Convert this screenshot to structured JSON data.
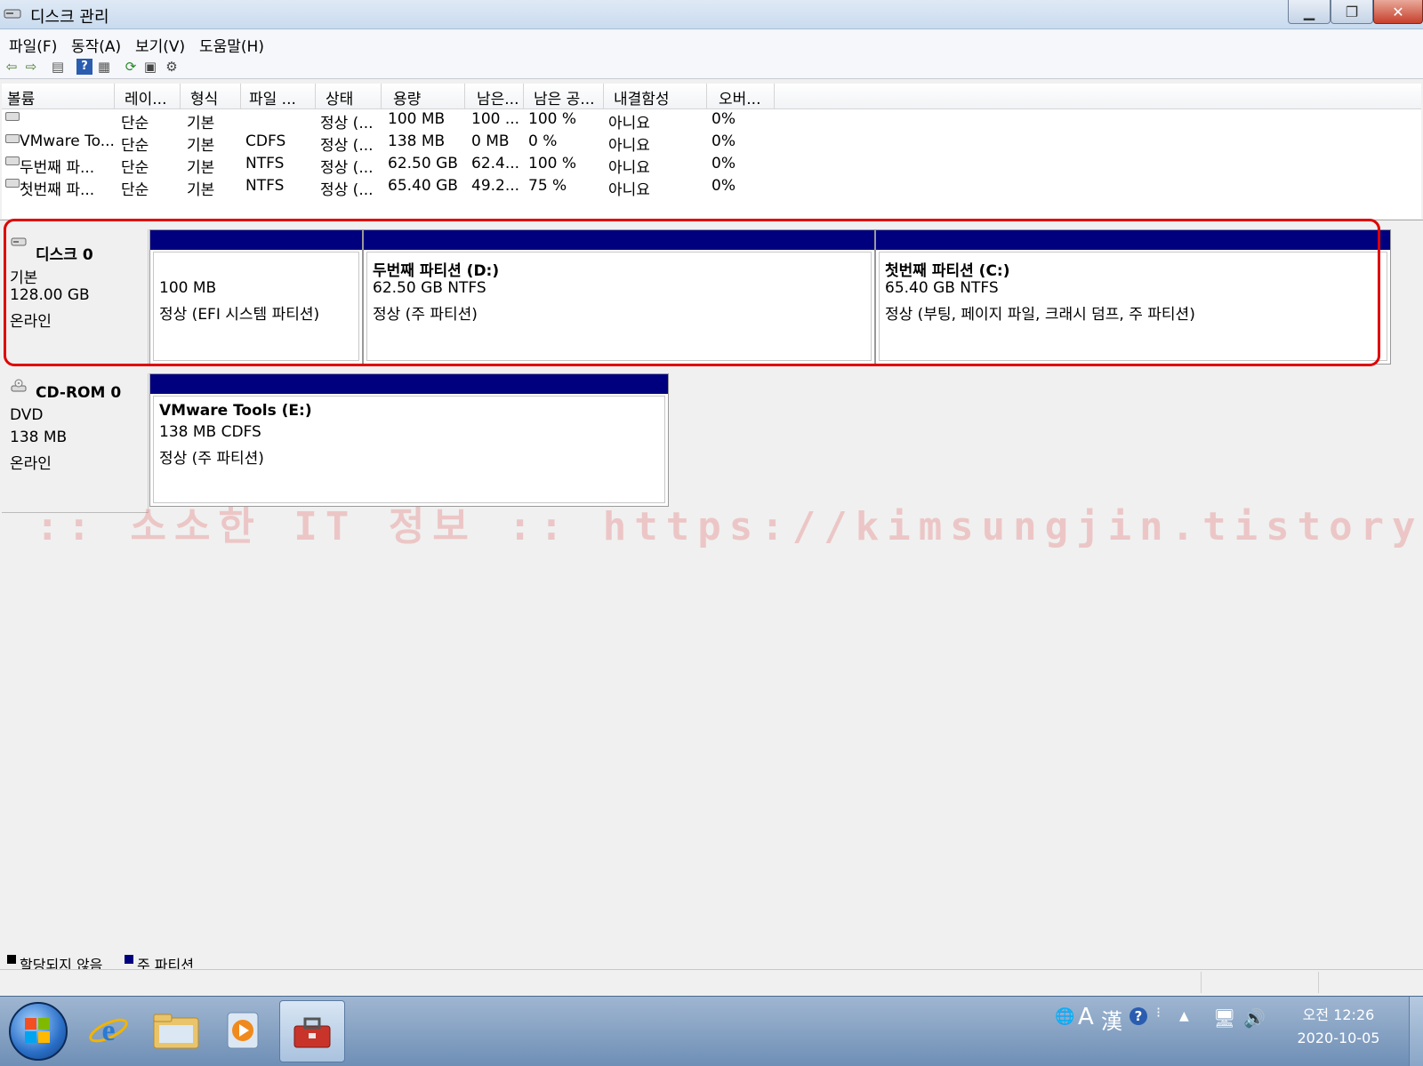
{
  "window": {
    "title": "디스크 관리"
  },
  "menu": [
    "파일(F)",
    "동작(A)",
    "보기(V)",
    "도움말(H)"
  ],
  "table": {
    "headers": [
      "볼륨",
      "레이...",
      "형식",
      "파일 ...",
      "상태",
      "용량",
      "남은...",
      "남은 공...",
      "내결함성",
      "오버..."
    ],
    "rows": [
      {
        "volume": "",
        "layout": "단순",
        "type": "기본",
        "fs": "",
        "status": "정상 (...",
        "capacity": "100 MB",
        "free": "100 ...",
        "pct": "100 %",
        "fault": "아니요",
        "overhead": "0%"
      },
      {
        "volume": "VMware To...",
        "layout": "단순",
        "type": "기본",
        "fs": "CDFS",
        "status": "정상 (...",
        "capacity": "138 MB",
        "free": "0 MB",
        "pct": "0 %",
        "fault": "아니요",
        "overhead": "0%"
      },
      {
        "volume": "두번째 파...",
        "layout": "단순",
        "type": "기본",
        "fs": "NTFS",
        "status": "정상 (...",
        "capacity": "62.50 GB",
        "free": "62.4...",
        "pct": "100 %",
        "fault": "아니요",
        "overhead": "0%"
      },
      {
        "volume": "첫번째 파...",
        "layout": "단순",
        "type": "기본",
        "fs": "NTFS",
        "status": "정상 (...",
        "capacity": "65.40 GB",
        "free": "49.2...",
        "pct": "75 %",
        "fault": "아니요",
        "overhead": "0%"
      }
    ]
  },
  "disks": [
    {
      "name": "디스크 0",
      "kind": "기본",
      "size": "128.00 GB",
      "state": "온라인",
      "partitions": [
        {
          "title": "",
          "size": "100 MB",
          "status": "정상 (EFI 시스템 파티션)"
        },
        {
          "title": "두번째 파티션  (D:)",
          "size": "62.50 GB NTFS",
          "status": "정상 (주 파티션)"
        },
        {
          "title": "첫번째 파티션  (C:)",
          "size": "65.40 GB NTFS",
          "status": "정상 (부팅, 페이지 파일, 크래시 덤프, 주 파티션)"
        }
      ]
    },
    {
      "name": "CD-ROM 0",
      "kind": "DVD",
      "size": "138 MB",
      "state": "온라인",
      "partitions": [
        {
          "title": "VMware Tools  (E:)",
          "size": "138 MB CDFS",
          "status": "정상 (주 파티션)"
        }
      ]
    }
  ],
  "watermark": ":: 소소한 IT 정보 :: https://kimsungjin.tistory.com ::",
  "legend": {
    "unallocated": "할당되지 않음",
    "unallocated_color": "#000000",
    "primary": "주 파티션",
    "primary_color": "#00007f"
  },
  "clock": {
    "time": "오전 12:26",
    "date": "2020-10-05"
  },
  "tray": {
    "ime_lang": "A",
    "ime_mode": "漢"
  }
}
